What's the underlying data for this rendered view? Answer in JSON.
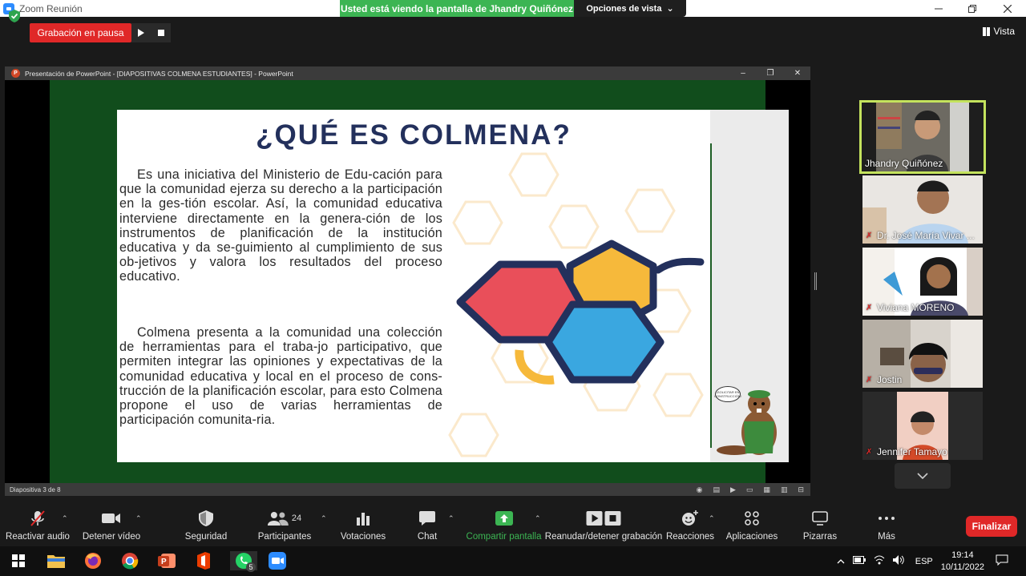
{
  "window": {
    "title": "Zoom Reunión"
  },
  "banner": {
    "sharing_text": "Usted está viendo la pantalla de Jhandry Quiñónez",
    "view_options": "Opciones de vista",
    "view_caret": "⌄"
  },
  "recording": {
    "status": "Grabación en pausa"
  },
  "view": {
    "label": "Vista"
  },
  "ppt": {
    "title": "Presentación de PowerPoint - [DIAPOSITIVAS COLMENA ESTUDIANTES] - PowerPoint",
    "status": "Diapositiva 3 de 8"
  },
  "slide": {
    "heading": "¿QUÉ ES COLMENA?",
    "paragraph1": "Es una iniciativa del Ministerio de Edu-cación para que la comunidad ejerza su derecho a la participación en la ges-tión escolar. Así, la comunidad educativa interviene directamente en la genera-ción de los instrumentos de planificación de la institución educativa y da se-guimiento al cumplimiento de sus ob-jetivos y valora los resultados del proceso educativo.",
    "paragraph2": "Colmena presenta a la comunidad una colección de herramientas para el traba-jo participativo, que permiten integrar las opiniones y expectativas de la comunidad educativa y local en el proceso de cons-trucción de la planificación escolar, para esto Colmena propone el uso de varias herramientas de participación comunita-ria.",
    "bubble_text": "¡SOLICITAR EN CONSTRUCCIÓN!"
  },
  "participants": [
    {
      "name": "Jhandry Quiñónez",
      "muted": false,
      "active": true
    },
    {
      "name": "Dr. José María Vivar ...",
      "muted": true
    },
    {
      "name": "Viviana MORENO",
      "muted": true
    },
    {
      "name": "Jostin",
      "muted": true
    },
    {
      "name": "Jennifer Tamayo",
      "muted": true
    }
  ],
  "toolbar": {
    "audio": "Reactivar audio",
    "video": "Detener vídeo",
    "security": "Seguridad",
    "participants": "Participantes",
    "participants_count": "24",
    "polls": "Votaciones",
    "chat": "Chat",
    "share": "Compartir pantalla",
    "record": "Reanudar/detener grabación",
    "reactions": "Reacciones",
    "apps": "Aplicaciones",
    "whiteboards": "Pizarras",
    "more": "Más",
    "end": "Finalizar"
  },
  "taskbar": {
    "whatsapp_badge": "5",
    "lang": "ESP",
    "time": "19:14",
    "date": "10/11/2022"
  },
  "colors": {
    "accent_green": "#3cb553",
    "recording_red": "#e02828",
    "slide_frame": "#114d1c",
    "heading_navy": "#23305c",
    "active_speaker": "#c4e35d"
  }
}
